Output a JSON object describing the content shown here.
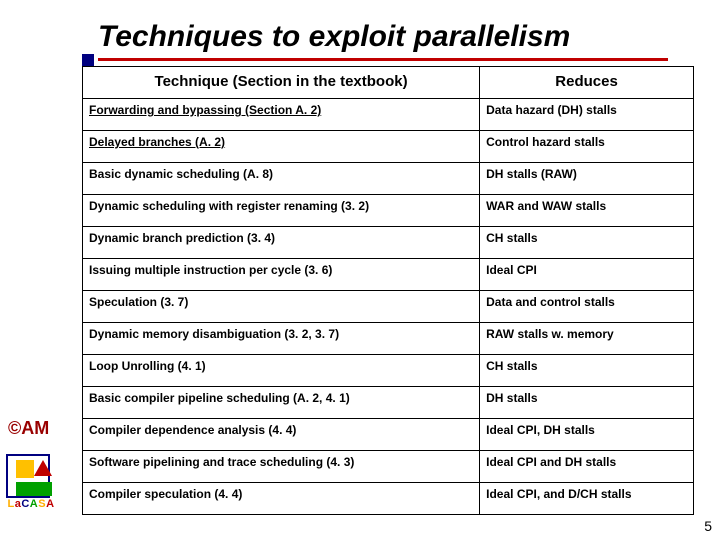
{
  "title": "Techniques to exploit parallelism",
  "headers": {
    "technique": "Technique (Section in the textbook)",
    "reduces": "Reduces"
  },
  "rows": [
    {
      "technique": "Forwarding and bypassing (Section A. 2)",
      "reduces": "Data hazard (DH) stalls",
      "underline": true
    },
    {
      "technique": "Delayed branches (A. 2)",
      "reduces": "Control hazard stalls",
      "underline": true
    },
    {
      "technique": "Basic dynamic scheduling (A. 8)",
      "reduces": "DH stalls (RAW)",
      "underline": false
    },
    {
      "technique": "Dynamic scheduling with register renaming (3. 2)",
      "reduces": "WAR and WAW stalls",
      "underline": false
    },
    {
      "technique": "Dynamic branch prediction (3. 4)",
      "reduces": "CH stalls",
      "underline": false
    },
    {
      "technique": "Issuing multiple instruction per cycle (3. 6)",
      "reduces": "Ideal CPI",
      "underline": false
    },
    {
      "technique": "Speculation (3. 7)",
      "reduces": "Data and control stalls",
      "underline": false
    },
    {
      "technique": "Dynamic memory disambiguation (3. 2, 3. 7)",
      "reduces": "RAW stalls w. memory",
      "underline": false
    },
    {
      "technique": "Loop Unrolling (4. 1)",
      "reduces": "CH stalls",
      "underline": false
    },
    {
      "technique": "Basic compiler pipeline scheduling (A. 2, 4. 1)",
      "reduces": "DH stalls",
      "underline": false
    },
    {
      "technique": "Compiler dependence analysis (4. 4)",
      "reduces": "Ideal CPI, DH stalls",
      "underline": false
    },
    {
      "technique": "Software pipelining and trace scheduling (4. 3)",
      "reduces": "Ideal CPI and DH stalls",
      "underline": false
    },
    {
      "technique": "Compiler speculation (4. 4)",
      "reduces": "Ideal CPI, and D/CH stalls",
      "underline": false
    }
  ],
  "copyright": "©AM",
  "logo_text": {
    "l1": "L",
    "l2": "a",
    "l3": "C",
    "l4": "A",
    "l5": "S",
    "l6": "A"
  },
  "page_number": "5"
}
